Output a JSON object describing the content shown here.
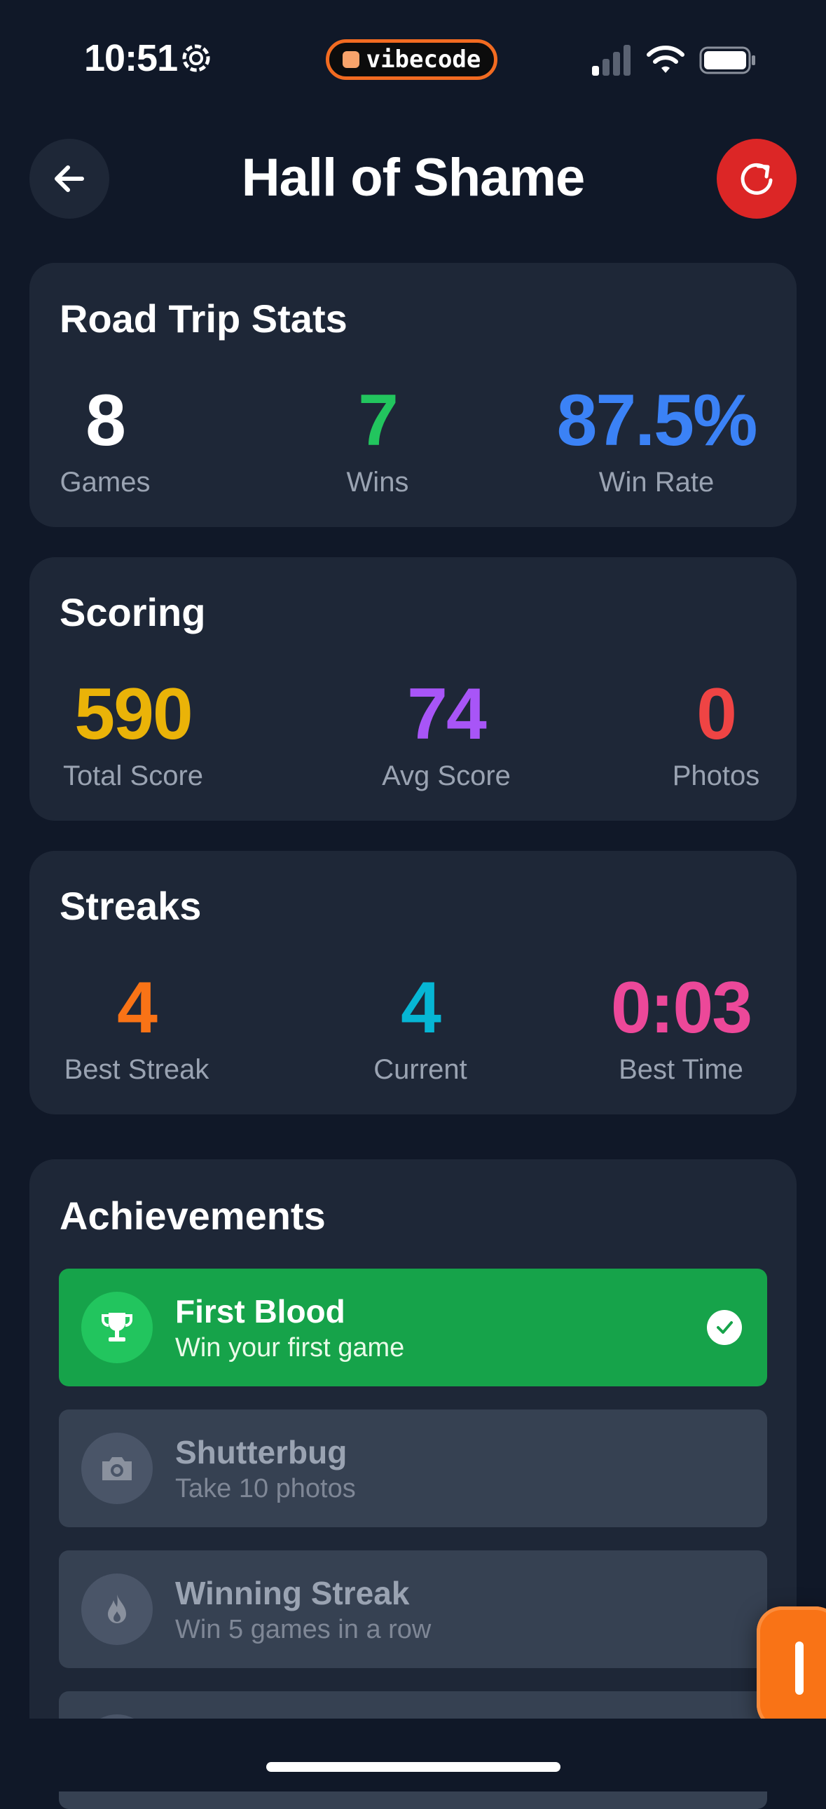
{
  "status_bar": {
    "time": "10:51",
    "app_pill": "vibecode"
  },
  "header": {
    "title": "Hall of Shame"
  },
  "road_trip": {
    "title": "Road Trip Stats",
    "stats": [
      {
        "value": "8",
        "label": "Games",
        "color": "#ffffff"
      },
      {
        "value": "7",
        "label": "Wins",
        "color": "#22c55e"
      },
      {
        "value": "87.5%",
        "label": "Win Rate",
        "color": "#3b82f6"
      }
    ]
  },
  "scoring": {
    "title": "Scoring",
    "stats": [
      {
        "value": "590",
        "label": "Total Score",
        "color": "#eab308"
      },
      {
        "value": "74",
        "label": "Avg Score",
        "color": "#a855f7"
      },
      {
        "value": "0",
        "label": "Photos",
        "color": "#ef4444"
      }
    ]
  },
  "streaks": {
    "title": "Streaks",
    "stats": [
      {
        "value": "4",
        "label": "Best Streak",
        "color": "#f97316"
      },
      {
        "value": "4",
        "label": "Current",
        "color": "#06b6d4"
      },
      {
        "value": "0:03",
        "label": "Best Time",
        "color": "#ec4899"
      }
    ]
  },
  "achievements": {
    "title": "Achievements",
    "items": [
      {
        "title": "First Blood",
        "desc": "Win your first game",
        "icon": "trophy-icon",
        "unlocked": true
      },
      {
        "title": "Shutterbug",
        "desc": "Take 10 photos",
        "icon": "camera-icon",
        "unlocked": false
      },
      {
        "title": "Winning Streak",
        "desc": "Win 5 games in a row",
        "icon": "flame-icon",
        "unlocked": false
      }
    ]
  }
}
